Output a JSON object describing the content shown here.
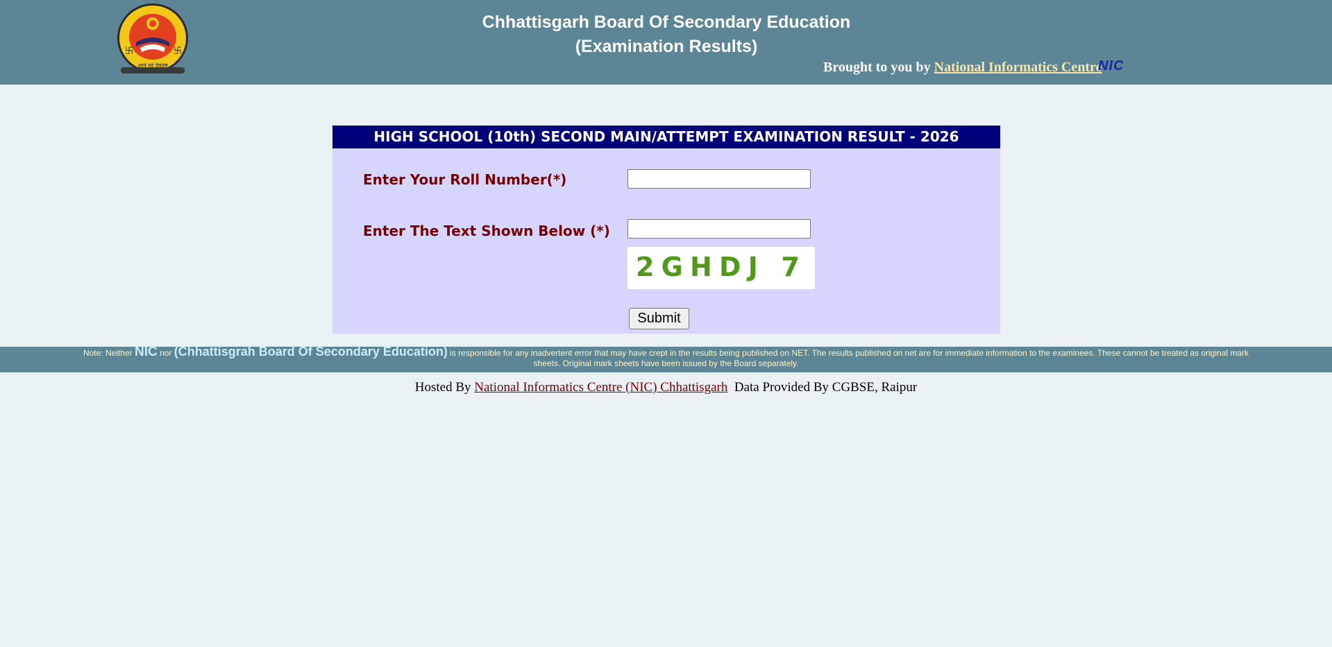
{
  "header": {
    "title_line1": "Chhattisgarh Board Of Secondary Education",
    "title_line2": "(Examination Results)",
    "brought_prefix": "Brought to you by",
    "brought_link": "National Informatics Centre",
    "nic_logo_text": "NIC",
    "colors": {
      "background": "#5c8596",
      "link": "#f6e7b0"
    }
  },
  "logo": {
    "icon": "cgbse-emblem-icon",
    "seal_text": "आनं परं देवतम्"
  },
  "form": {
    "title": "HIGH SCHOOL (10th) SECOND MAIN/ATTEMPT EXAMINATION RESULT - 2026",
    "roll_label": "Enter Your Roll Number(*)",
    "roll_value": "",
    "captcha_label": "Enter The Text Shown Below (*)",
    "captcha_value": "",
    "captcha_text": "2GHDJ 7",
    "submit_label": "Submit",
    "colors": {
      "panel": "#d5d5fe",
      "title_bar": "#00007a",
      "label": "#7a0000"
    }
  },
  "note": {
    "prefix": "Note: Neither",
    "nic": "NIC",
    "nor": "nor",
    "board": "(Chhattisgrah Board Of Secondary Education)",
    "rest": "is responsible for any inadvertent error that may have crept in the results being published on NET. The results published on net are for immediate information to the examinees. These cannot be treated as original mark sheets. Original mark sheets have been issued by the Board separately."
  },
  "footer": {
    "hosted_prefix": "Hosted By",
    "hosted_link": "National Informatics Centre (NIC) Chhattisgarh",
    "data_provided": "Data Provided By CGBSE, Raipur"
  }
}
